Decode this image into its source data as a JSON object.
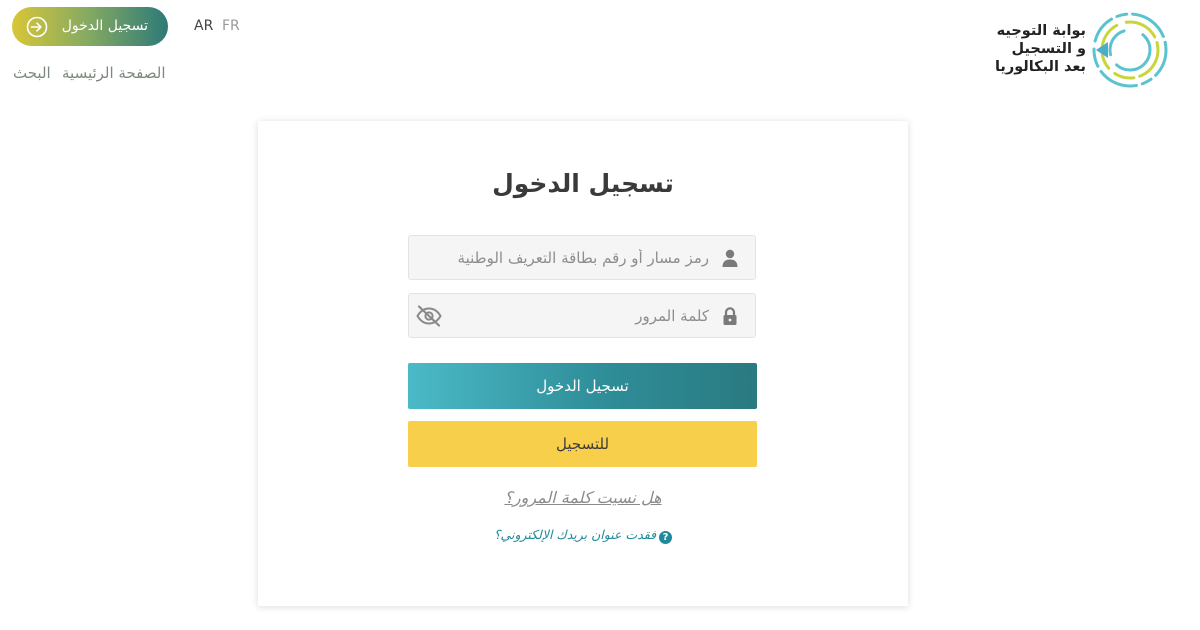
{
  "header": {
    "login_pill_label": "تسجيل الدخول",
    "languages": [
      "AR",
      "FR"
    ],
    "nav": {
      "home": "الصفحة الرئيسية",
      "search": "البحث"
    },
    "logo_lines": [
      "بوابة التوجيه",
      "و التسجيل",
      "بعد البكالوريا"
    ]
  },
  "card": {
    "title": "تسجيل الدخول",
    "username_placeholder": "رمز مسار أو رقم بطاقة التعريف الوطنية",
    "password_placeholder": "كلمة المرور",
    "login_button": "تسجيل الدخول",
    "register_button": "للتسجيل",
    "forgot_password": "هل نسيت كلمة المرور؟",
    "lost_email": "فقدت عنوان بريدك الإلكتروني؟",
    "lost_email_icon": "?"
  },
  "icons": {
    "login": "login-arrow-icon",
    "user": "user-icon",
    "lock": "lock-icon",
    "password_toggle": "eye-slash-icon",
    "help": "question-circle-icon",
    "logo": "portal-logo"
  },
  "colors": {
    "primary_teal": "#2f8e99",
    "accent_yellow": "#f7cf4a",
    "pill_start": "#d8c637",
    "pill_end": "#2d7a78",
    "link_teal": "#1f8a9b"
  }
}
